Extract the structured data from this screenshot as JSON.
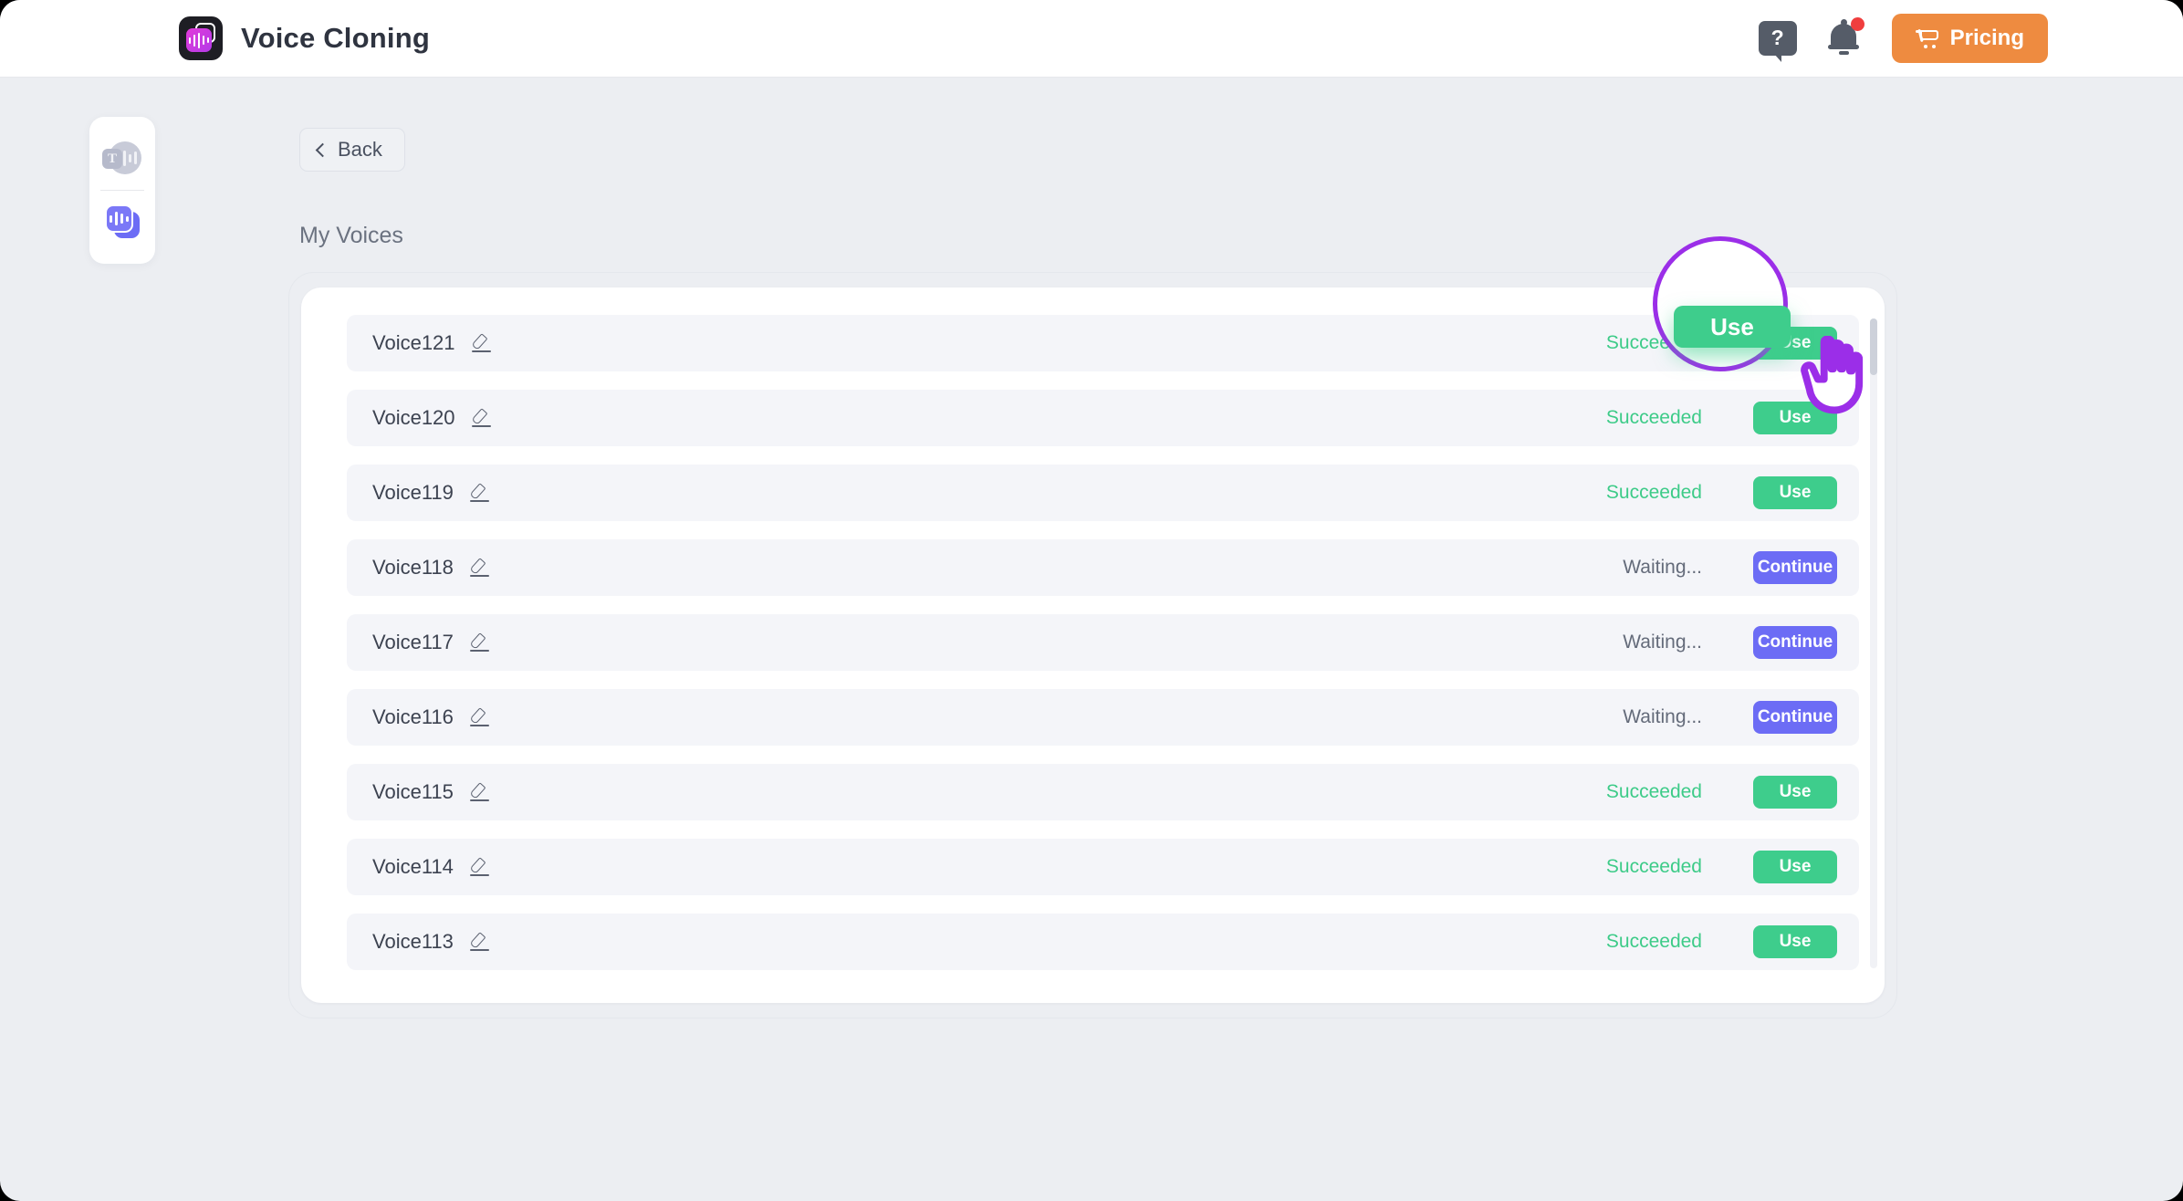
{
  "header": {
    "app_title": "Voice Cloning",
    "logo_icon": "voice-cloning-logo-icon",
    "help_label": "?",
    "help_icon": "help-question-bubble-icon",
    "notification_icon": "bell-icon",
    "notification_badge": "",
    "pricing_label": "Pricing",
    "pricing_icon": "shopping-cart-icon",
    "pricing_color": "#EE8B40"
  },
  "sidebar": {
    "items": [
      {
        "name": "text-to-speech",
        "icon": "text-to-speech-icon",
        "active": false
      },
      {
        "name": "voice-cloning",
        "icon": "voice-cloning-icon",
        "active": true
      }
    ]
  },
  "main": {
    "back_label": "Back",
    "back_icon": "chevron-left-icon",
    "section_title": "My Voices",
    "edit_icon": "pencil-edit-icon",
    "status_colors": {
      "succeeded": "#3DCB88",
      "waiting": "#646B7A"
    },
    "button_colors": {
      "use": "#3ECD8C",
      "continue": "#6C6CF5"
    },
    "voices": [
      {
        "name": "Voice121",
        "status": "Succeeded",
        "action": "Use"
      },
      {
        "name": "Voice120",
        "status": "Succeeded",
        "action": "Use"
      },
      {
        "name": "Voice119",
        "status": "Succeeded",
        "action": "Use"
      },
      {
        "name": "Voice118",
        "status": "Waiting...",
        "action": "Continue"
      },
      {
        "name": "Voice117",
        "status": "Waiting...",
        "action": "Continue"
      },
      {
        "name": "Voice116",
        "status": "Waiting...",
        "action": "Continue"
      },
      {
        "name": "Voice115",
        "status": "Succeeded",
        "action": "Use"
      },
      {
        "name": "Voice114",
        "status": "Succeeded",
        "action": "Use"
      },
      {
        "name": "Voice113",
        "status": "Succeeded",
        "action": "Use"
      }
    ]
  },
  "highlight": {
    "target_label": "Use",
    "circle_color": "#9B2EE8",
    "cursor_icon": "hand-pointer-cursor-icon"
  }
}
